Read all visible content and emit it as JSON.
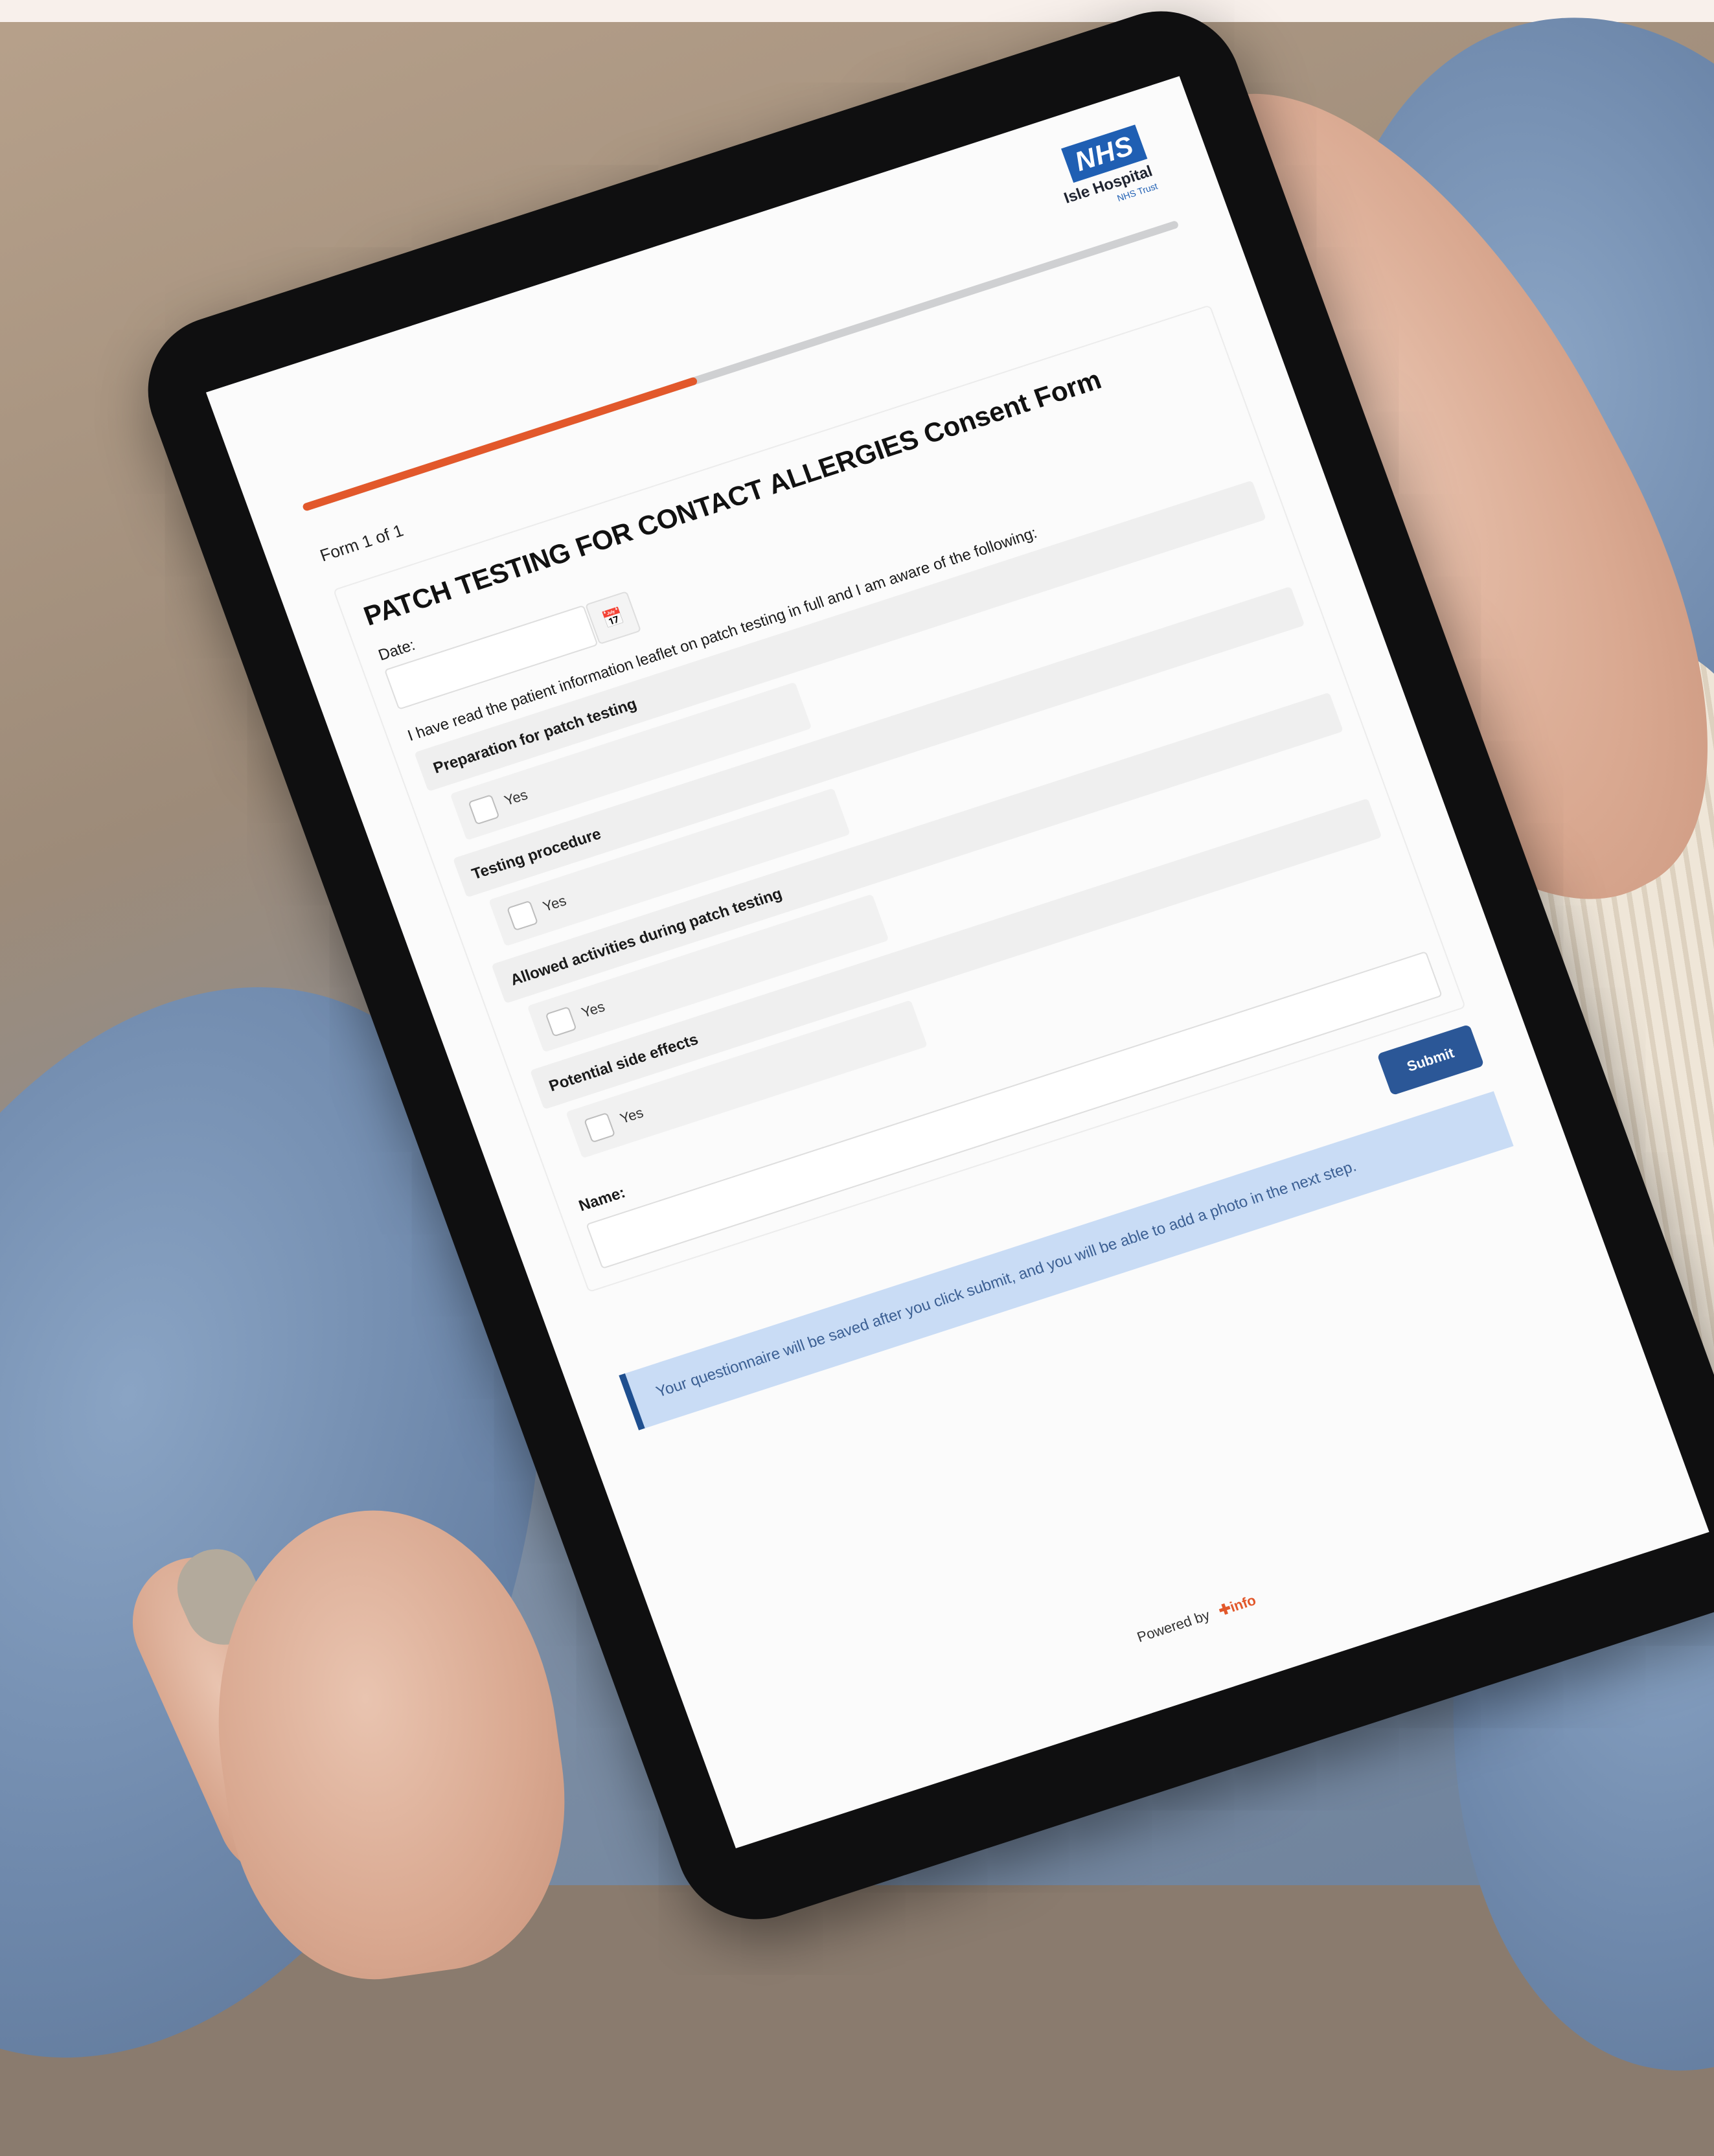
{
  "header": {
    "logo_badge": "NHS",
    "hospital_name": "Isle Hospital",
    "trust_name": "NHS Trust"
  },
  "progress": {
    "fraction": 0.45
  },
  "form": {
    "counter": "Form 1 of 1",
    "title": "PATCH TESTING FOR CONTACT ALLERGIES Consent Form",
    "date_label": "Date:",
    "statement": "I have read the patient information leaflet on patch testing in full and I am aware of the following:",
    "questions": [
      {
        "label": "Preparation for patch testing",
        "option": "Yes"
      },
      {
        "label": "Testing procedure",
        "option": "Yes"
      },
      {
        "label": "Allowed activities during patch testing",
        "option": "Yes"
      },
      {
        "label": "Potential side effects",
        "option": "Yes"
      }
    ],
    "name_label": "Name:"
  },
  "actions": {
    "submit_label": "Submit"
  },
  "notice": {
    "text": "Your questionnaire will be saved after you click submit, and you will be able to add a photo in the next step."
  },
  "footer": {
    "powered_by": "Powered by",
    "brand": "✚info"
  },
  "colors": {
    "accent": "#e2582b",
    "primary": "#2b5797",
    "nhs_blue": "#1f5fb3",
    "banner_bg": "#c9dcf5"
  }
}
